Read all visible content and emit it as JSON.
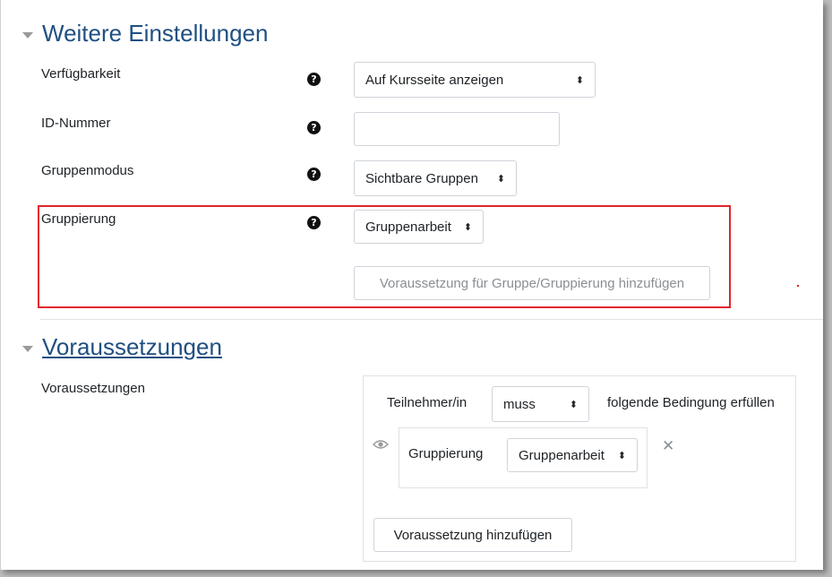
{
  "sections": {
    "further_settings": {
      "title": "Weitere Einstellungen"
    },
    "prerequisites": {
      "title": "Voraussetzungen"
    }
  },
  "fields": {
    "availability": {
      "label": "Verfügbarkeit",
      "value": "Auf Kursseite anzeigen",
      "help_icon": "question-circle-icon"
    },
    "id_number": {
      "label": "ID-Nummer",
      "value": "",
      "help_icon": "question-circle-icon"
    },
    "group_mode": {
      "label": "Gruppenmodus",
      "value": "Sichtbare Gruppen",
      "help_icon": "question-circle-icon"
    },
    "grouping": {
      "label": "Gruppierung",
      "value": "Gruppenarbeit",
      "help_icon": "question-circle-icon"
    },
    "add_group_restriction": {
      "label": "Voraussetzung für Gruppe/Gruppierung hinzufügen"
    }
  },
  "restrictions": {
    "label": "Voraussetzungen",
    "participant_text": "Teilnehmer/in",
    "must_value": "muss",
    "condition_text": "folgende Bedingung erfüllen",
    "condition": {
      "eye_icon": "eye-icon",
      "type_label": "Gruppierung",
      "value": "Gruppenarbeit",
      "remove_icon": "close-icon"
    },
    "add_button": "Voraussetzung hinzufügen"
  },
  "glyphs": {
    "help": "?",
    "arrows": "⬍",
    "close": "✕"
  },
  "colors": {
    "highlight_box": "#e0262c",
    "section_title": "#1f4f82"
  }
}
